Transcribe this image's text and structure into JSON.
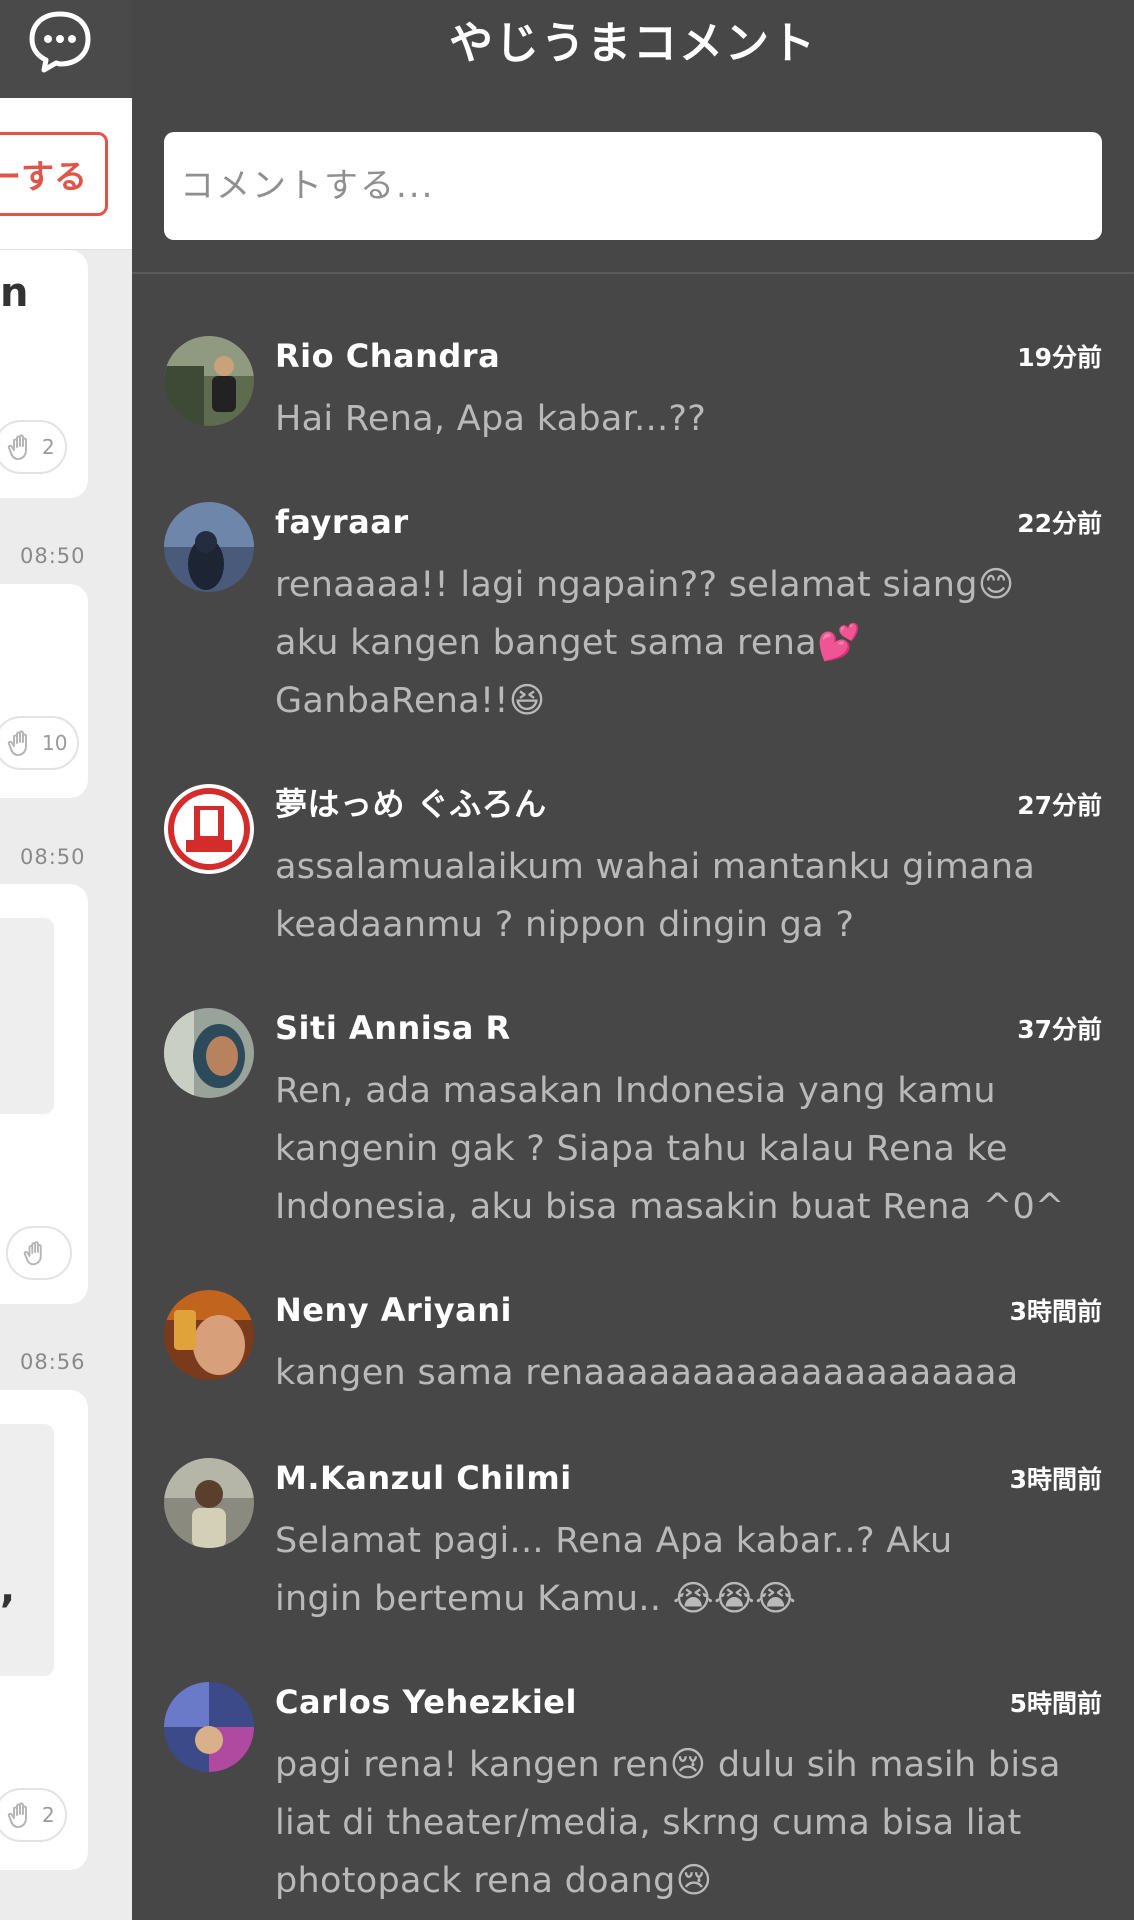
{
  "left_panel": {
    "follow_button": "ーする",
    "times": [
      "08:50",
      "08:50",
      "08:56"
    ],
    "clap_counts": [
      "2",
      "10",
      "",
      "2"
    ],
    "card_glyphs": [
      "n",
      ","
    ]
  },
  "overlay": {
    "title": "やじうまコメント",
    "input_placeholder": "コメントする...",
    "comments": [
      {
        "name": "Rio Chandra",
        "time": "19分前",
        "text": "Hai Rena, Apa kabar...??"
      },
      {
        "name": "fayraar",
        "time": "22分前",
        "text": "renaaaa!! lagi ngapain??  selamat siang😊\naku kangen banget sama rena💕\nGanbaRena!!😆"
      },
      {
        "name": "夢はっめ ぐふろん",
        "time": "27分前",
        "text": "assalamualaikum wahai mantanku   gimana\nkeadaanmu ?   nippon dingin ga ?"
      },
      {
        "name": "Siti Annisa R",
        "time": "37分前",
        "text": "Ren, ada masakan Indonesia yang kamu\nkangenin gak ? Siapa tahu kalau Rena ke\nIndonesia, aku bisa masakin buat Rena ^0^"
      },
      {
        "name": "Neny Ariyani",
        "time": "3時間前",
        "text": "kangen sama renaaaaaaaaaaaaaaaaaaaa"
      },
      {
        "name": "M.Kanzul Chilmi",
        "time": "3時間前",
        "text": "Selamat pagi... Rena     Apa kabar..?   Aku\ningin bertemu Kamu.. 😭😭😭"
      },
      {
        "name": "Carlos Yehezkiel",
        "time": "5時間前",
        "text": "pagi rena! kangen ren😢 dulu sih masih bisa\nliat di theater/media, skrng cuma bisa liat\nphotopack rena doang😢"
      }
    ]
  }
}
